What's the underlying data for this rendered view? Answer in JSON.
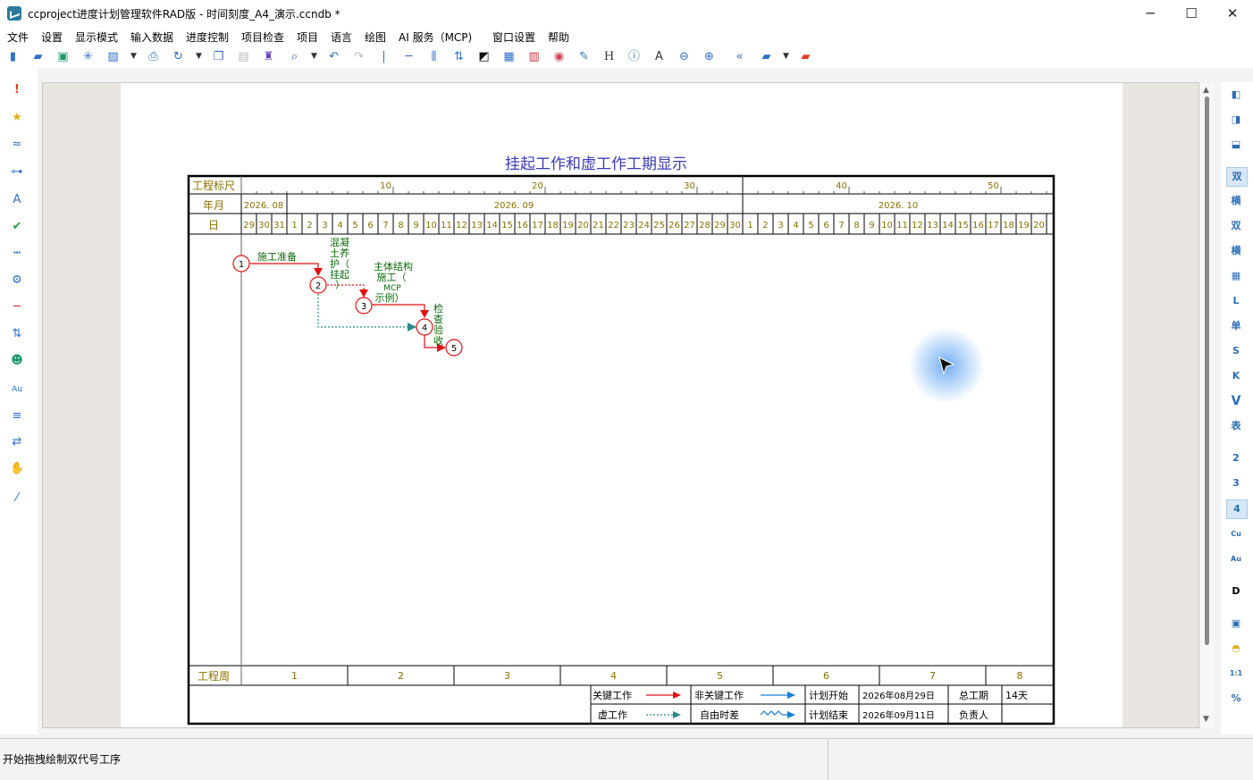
{
  "window": {
    "title": "ccproject进度计划管理软件RAD版 - 时间刻度_A4_演示.ccndb *",
    "minimize": "─",
    "maximize": "☐",
    "close": "✕"
  },
  "menu": [
    "文件",
    "设置",
    "显示模式",
    "输入数据",
    "进度控制",
    "项目检查",
    "项目",
    "语言",
    "绘图",
    "AI 服务（MCP)",
    "窗口设置",
    "帮助"
  ],
  "chart": {
    "title": "挂起工作和虚工作工期显示",
    "row_labels": {
      "ruler": "工程标尺",
      "month": "年月",
      "day": "日",
      "week": "工程周"
    },
    "ruler_ticks": [
      "10",
      "20",
      "30",
      "40",
      "50"
    ],
    "months": [
      "2026. 08",
      "2026. 09",
      "2026. 10"
    ],
    "days": [
      "29",
      "30",
      "31",
      "1",
      "2",
      "3",
      "4",
      "5",
      "6",
      "7",
      "8",
      "9",
      "10",
      "11",
      "12",
      "13",
      "14",
      "15",
      "16",
      "17",
      "18",
      "19",
      "20",
      "21",
      "22",
      "23",
      "24",
      "25",
      "26",
      "27",
      "28",
      "29",
      "30",
      "1",
      "2",
      "3",
      "4",
      "5",
      "6",
      "7",
      "8",
      "9",
      "10",
      "11",
      "12",
      "13",
      "14",
      "15",
      "16",
      "17",
      "18",
      "19",
      "20"
    ],
    "weeks": [
      "1",
      "2",
      "3",
      "4",
      "5",
      "6",
      "7",
      "8"
    ],
    "nodes": [
      "1",
      "2",
      "3",
      "4",
      "5"
    ],
    "tasks": {
      "t1": "施工准备",
      "t2": [
        "混凝",
        "土养",
        "护（",
        "挂起",
        "）"
      ],
      "t3": [
        "主体结构",
        "施工（",
        "MCP",
        "示例）"
      ],
      "t4": [
        "检",
        "查",
        "验",
        "收"
      ]
    },
    "legend": {
      "critical": "关键工作",
      "noncritical": "非关键工作",
      "dummy": "虚工作",
      "float": "自由时差",
      "plan_start_label": "计划开始",
      "plan_start": "2026年08月29日",
      "plan_end_label": "计划结束",
      "plan_end": "2026年09月11日",
      "duration_label": "总工期",
      "duration": "14天",
      "owner_label": "负责人",
      "owner": ""
    }
  },
  "right_tools": [
    "双",
    "横",
    "双",
    "横",
    "L",
    "单",
    "S",
    "K",
    "V",
    "表",
    "2",
    "3",
    "4",
    "Cu",
    "Au",
    "D",
    "1:1",
    "%"
  ],
  "status": {
    "message": "开始拖拽绘制双代号工序"
  },
  "colors": {
    "critical": "#e01010",
    "noncritical": "#1a7fd4",
    "dummy": "#2a8a8a",
    "text_green": "#0a6a0a",
    "title_blue": "#3b3bb8",
    "gold": "#8a7000"
  }
}
